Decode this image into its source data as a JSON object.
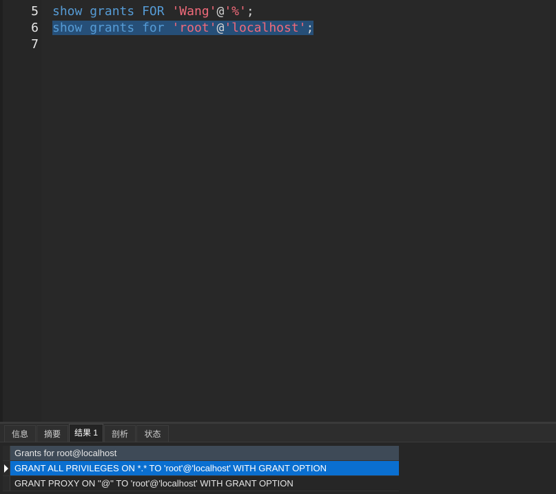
{
  "editor": {
    "lines": [
      {
        "number": "5",
        "tokens": [
          {
            "text": "show",
            "type": "kw"
          },
          {
            "text": " ",
            "type": "op"
          },
          {
            "text": "grants",
            "type": "kw"
          },
          {
            "text": " ",
            "type": "op"
          },
          {
            "text": "FOR",
            "type": "kw"
          },
          {
            "text": " ",
            "type": "op"
          },
          {
            "text": "'Wang'",
            "type": "str"
          },
          {
            "text": "@",
            "type": "op"
          },
          {
            "text": "'%'",
            "type": "str"
          },
          {
            "text": ";",
            "type": "op"
          }
        ]
      },
      {
        "number": "6",
        "selected": true,
        "tokens": [
          {
            "text": "show",
            "type": "kw"
          },
          {
            "text": " ",
            "type": "op"
          },
          {
            "text": "grants",
            "type": "kw"
          },
          {
            "text": " ",
            "type": "op"
          },
          {
            "text": "for",
            "type": "kw"
          },
          {
            "text": " ",
            "type": "op"
          },
          {
            "text": "'root'",
            "type": "str"
          },
          {
            "text": "@",
            "type": "op"
          },
          {
            "text": "'localhost'",
            "type": "str"
          },
          {
            "text": ";",
            "type": "op"
          }
        ]
      },
      {
        "number": "7",
        "tokens": []
      }
    ]
  },
  "tabs": [
    {
      "label": "信息",
      "active": false
    },
    {
      "label": "摘要",
      "active": false
    },
    {
      "label": "结果 1",
      "active": true
    },
    {
      "label": "剖析",
      "active": false
    },
    {
      "label": "状态",
      "active": false
    }
  ],
  "results": {
    "column_header": "Grants for root@localhost",
    "rows": [
      {
        "value": "GRANT ALL PRIVILEGES ON *.* TO 'root'@'localhost' WITH GRANT OPTION",
        "selected": true
      },
      {
        "value": "GRANT PROXY ON ''@'' TO 'root'@'localhost' WITH GRANT OPTION",
        "selected": false
      }
    ]
  },
  "colors": {
    "keyword": "#569cd6",
    "string": "#f06a7a",
    "selection": "#264f78",
    "row_selected": "#0a6fd0"
  }
}
